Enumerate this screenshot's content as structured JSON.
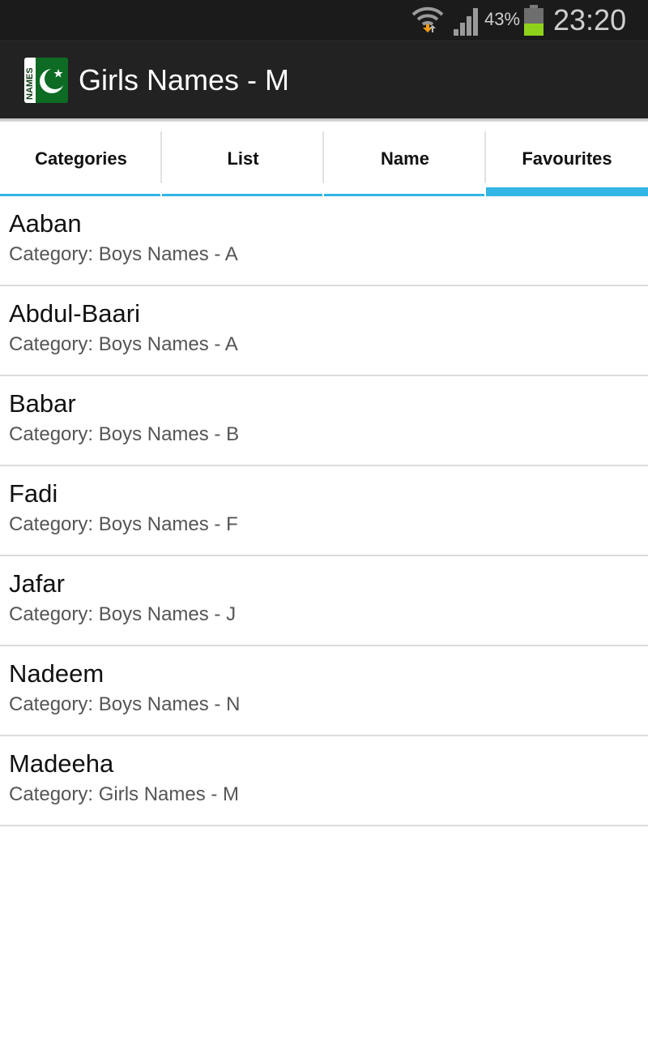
{
  "status_bar": {
    "battery_percent": "43%",
    "battery_level": 0.43,
    "time": "23:20",
    "icons": [
      "wifi-icon",
      "signal-icon",
      "battery-icon"
    ]
  },
  "app_bar": {
    "title": "Girls Names - M",
    "icon_text": "NAMES"
  },
  "tabs": [
    {
      "label": "Categories",
      "selected": false
    },
    {
      "label": "List",
      "selected": false
    },
    {
      "label": "Name",
      "selected": false
    },
    {
      "label": "Favourites",
      "selected": true
    }
  ],
  "favourites": [
    {
      "name": "Aaban",
      "category": "Category: Boys Names - A"
    },
    {
      "name": "Abdul-Baari",
      "category": "Category: Boys Names - A"
    },
    {
      "name": "Babar",
      "category": "Category: Boys Names - B"
    },
    {
      "name": "Fadi",
      "category": "Category: Boys Names - F"
    },
    {
      "name": "Jafar",
      "category": "Category: Boys Names - J"
    },
    {
      "name": "Nadeem",
      "category": "Category: Boys Names - N"
    },
    {
      "name": "Madeeha",
      "category": "Category: Girls Names - M"
    }
  ],
  "colors": {
    "accent": "#33b5e5",
    "action_bar": "#222222",
    "status_bar": "#1b1b1b",
    "battery_fill": "#8fd21b"
  }
}
